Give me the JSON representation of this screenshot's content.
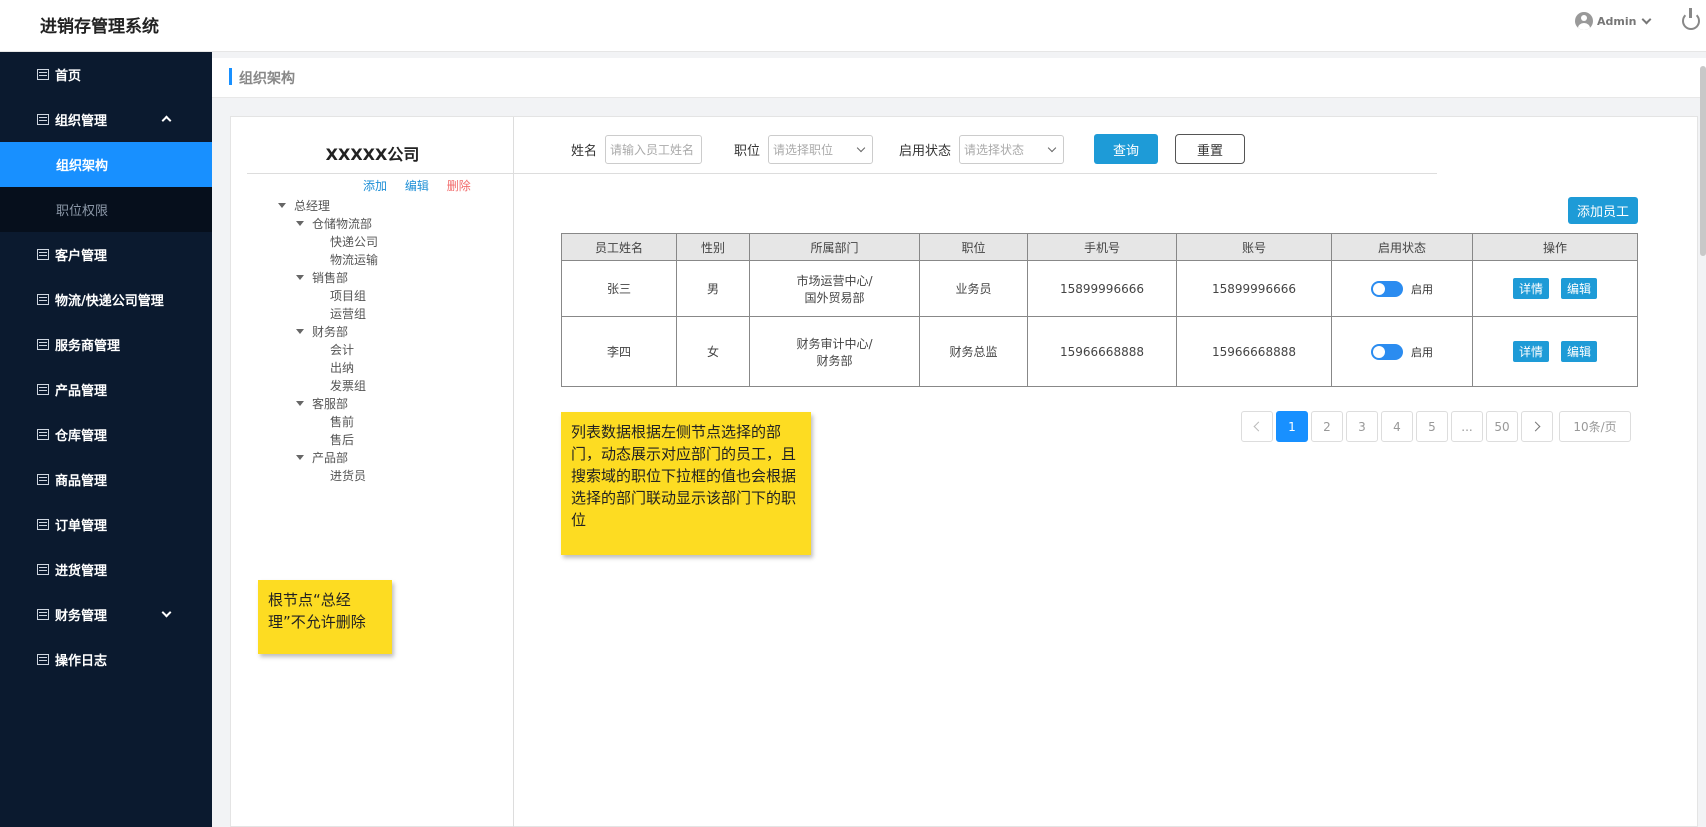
{
  "app_title": "进销存管理系统",
  "user": {
    "name": "Admin"
  },
  "sidebar": {
    "items": [
      {
        "label": "首页"
      },
      {
        "label": "组织管理",
        "expanded": true,
        "children": [
          {
            "label": "组织架构",
            "active": true
          },
          {
            "label": "职位权限"
          }
        ]
      },
      {
        "label": "客户管理"
      },
      {
        "label": "物流/快递公司管理"
      },
      {
        "label": "服务商管理"
      },
      {
        "label": "产品管理"
      },
      {
        "label": "仓库管理"
      },
      {
        "label": "商品管理"
      },
      {
        "label": "订单管理"
      },
      {
        "label": "进货管理"
      },
      {
        "label": "财务管理",
        "collapsed": true
      },
      {
        "label": "操作日志"
      }
    ]
  },
  "breadcrumb": "组织架构",
  "company": "XXXXX公司",
  "tree_actions": {
    "add": "添加",
    "edit": "编辑",
    "delete": "删除"
  },
  "tree": {
    "root": "总经理",
    "departments": [
      {
        "name": "仓储物流部",
        "children": [
          "快递公司",
          "物流运输"
        ]
      },
      {
        "name": "销售部",
        "children": [
          "项目组",
          "运营组"
        ]
      },
      {
        "name": "财务部",
        "children": [
          "会计",
          "出纳",
          "发票组"
        ]
      },
      {
        "name": "客服部",
        "children": [
          "售前",
          "售后"
        ]
      },
      {
        "name": "产品部",
        "children": [
          "进货员"
        ]
      }
    ]
  },
  "search": {
    "name_label": "姓名",
    "name_placeholder": "请输入员工姓名",
    "position_label": "职位",
    "position_placeholder": "请选择职位",
    "status_label": "启用状态",
    "status_placeholder": "请选择状态",
    "query_button": "查询",
    "reset_button": "重置"
  },
  "add_employee_button": "添加员工",
  "table": {
    "headers": [
      "员工姓名",
      "性别",
      "所属部门",
      "职位",
      "手机号",
      "账号",
      "启用状态",
      "操作"
    ],
    "rows": [
      {
        "name": "张三",
        "gender": "男",
        "dept_line1": "市场运营中心/",
        "dept_line2": "国外贸易部",
        "position": "业务员",
        "phone": "15899996666",
        "account": "15899996666",
        "status": "启用"
      },
      {
        "name": "李四",
        "gender": "女",
        "dept_line1": "财务审计中心/",
        "dept_line2": "财务部",
        "position": "财务总监",
        "phone": "15966668888",
        "account": "15966668888",
        "status": "启用"
      }
    ],
    "detail_label": "详情",
    "edit_label": "编辑"
  },
  "pager": {
    "pages": [
      "1",
      "2",
      "3",
      "4",
      "5",
      "...",
      "50"
    ],
    "current": "1",
    "page_size": "10条/页"
  },
  "notes": {
    "left": "根节点“总经理”不允许删除",
    "right": "列表数据根据左侧节点选择的部门，动态展示对应部门的员工，且搜索域的职位下拉框的值也会根据选择的部门联动显示该部门下的职位"
  },
  "colors": {
    "sidebar_bg": "#0b1a2f",
    "active": "#1890ff",
    "button": "#1e9bd7",
    "note": "#fddc22"
  }
}
